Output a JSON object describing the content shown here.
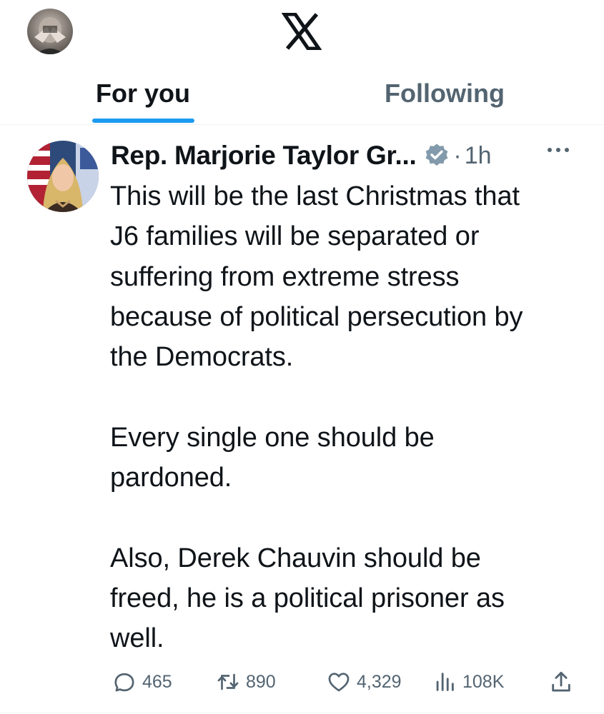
{
  "header": {
    "user_avatar": "profile-avatar",
    "logo": "x-logo"
  },
  "tabs": [
    {
      "label": "For you",
      "active": true
    },
    {
      "label": "Following",
      "active": false
    }
  ],
  "tweet": {
    "author_name": "Rep. Marjorie Taylor Gr...",
    "verified": "verified-badge-icon",
    "separator": "·",
    "time": "1h",
    "more_icon": "more-icon",
    "text": "This will be the last Christmas that\nJ6 families will be separated or\nsuffering from extreme stress\nbecause of political persecution by\nthe Democrats.\n\nEvery single one should be\npardoned.\n\nAlso, Derek Chauvin should be\nfreed, he is a political prisoner as\nwell.",
    "actions": {
      "replies": "465",
      "retweets": "890",
      "likes": "4,329",
      "views": "108K"
    }
  },
  "colors": {
    "accent": "#1d9bf0",
    "text": "#0f1419",
    "muted": "#536471",
    "badge": "#829aab"
  }
}
